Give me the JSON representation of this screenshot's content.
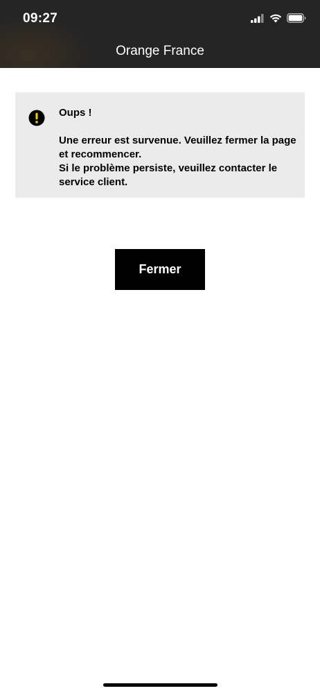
{
  "status_bar": {
    "time": "09:27",
    "icons": [
      "cellular-signal-icon",
      "wifi-icon",
      "battery-icon"
    ]
  },
  "nav": {
    "title": "Orange France"
  },
  "error": {
    "icon": "exclamation-circle-icon",
    "title": "Oups !",
    "message_line1": "Une erreur est survenue. Veuillez fermer la page et recommencer.",
    "message_line2": "Si le problème persiste, veuillez contacter le service client."
  },
  "actions": {
    "close_label": "Fermer"
  },
  "colors": {
    "header_background": "#232323",
    "error_box_background": "#ebebeb",
    "button_background": "#000000",
    "icon_accent": "#f5c400"
  }
}
